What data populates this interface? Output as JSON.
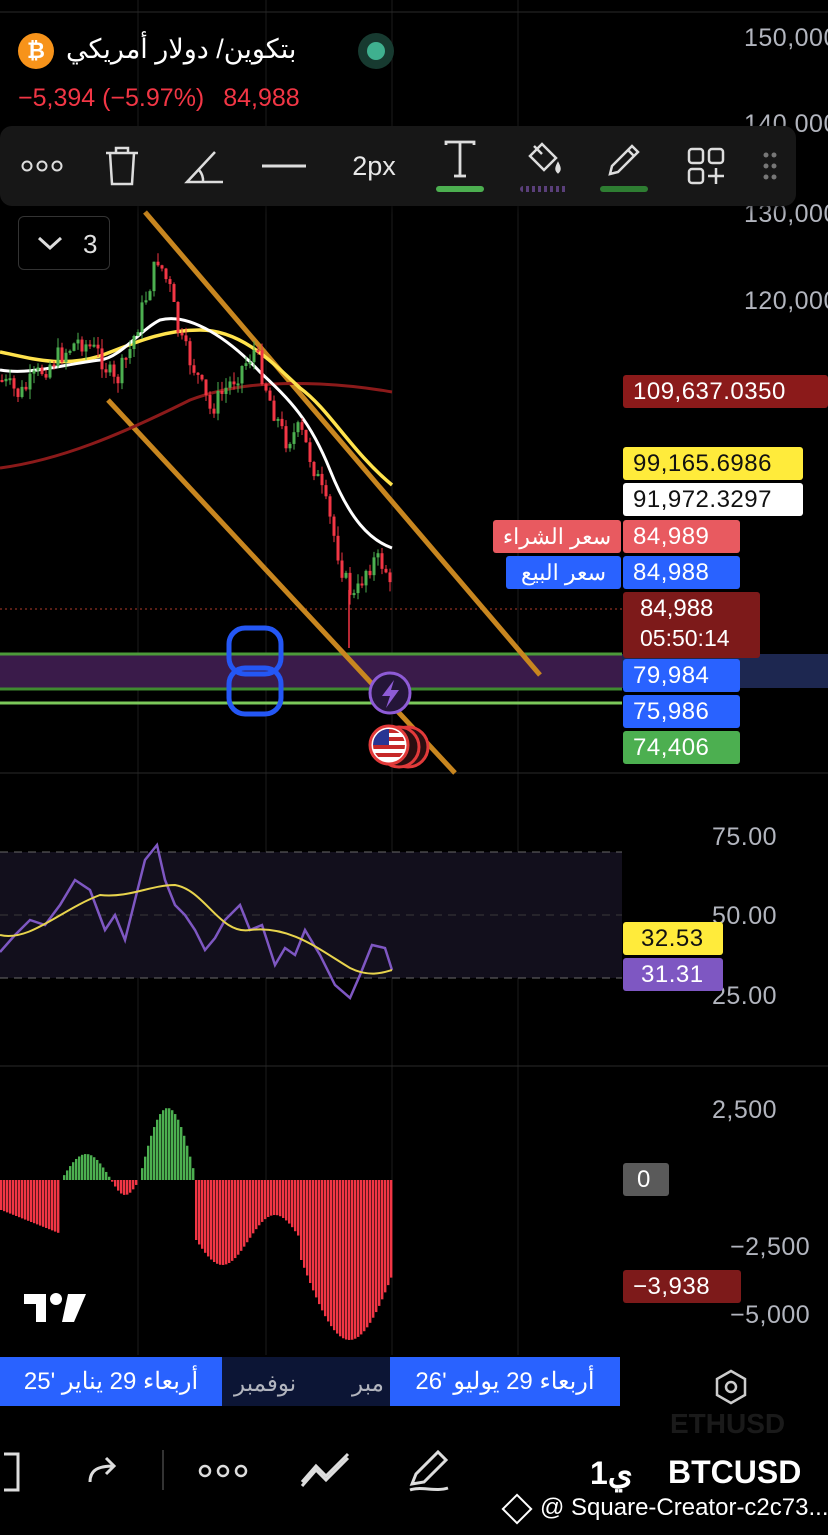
{
  "symbol": {
    "title": "بتكوين/ دولار أمريكي",
    "change": "−5,394 (−5.97%)",
    "price": "84,988",
    "icon": "bitcoin-icon"
  },
  "toolbar": {
    "more_label": "∘∘∘",
    "width_label": "2px"
  },
  "legend": {
    "collapse_count": "3"
  },
  "price_axis": [
    "150,000",
    "140,000",
    "130,000",
    "120,000"
  ],
  "price_badges": {
    "ma200": "109,637.0350",
    "ma_yellow": "99,165.6986",
    "ma_white": "91,972.3297",
    "buy_label": "سعر الشراء",
    "buy_price": "84,989",
    "sell_label": "سعر البيع",
    "sell_price": "84,988",
    "last_price": "84,988",
    "countdown": "05:50:14",
    "line1": "79,984",
    "line2": "75,986",
    "line3": "74,406"
  },
  "rsi": {
    "axis": [
      "75.00",
      "50.00",
      "25.00"
    ],
    "ma_value": "32.53",
    "rsi_value": "31.31"
  },
  "macd": {
    "axis": [
      "2,500",
      "0",
      "−2,500",
      "−5,000"
    ],
    "value": "−3,938"
  },
  "time_axis": {
    "left_badge": "أربعاء 29 يناير '25",
    "mid_label": "نوفمبر",
    "partial_label": "مبر",
    "right_badge": "أربعاء 29 يوليو '26"
  },
  "bottom": {
    "interval": "1ي",
    "ticker": "BTCUSD",
    "ghost_ticker": "ETHUSD",
    "more": "∘∘∘",
    "credit": "@ Square-Creator-c2c73..."
  },
  "colors": {
    "bg": "#000000",
    "up": "#4caf50",
    "down": "#f23645",
    "ma200": "#8b1a1a",
    "ma_yellow": "#ffeb3b",
    "channel": "#c8861f",
    "blue_badge": "#2962ff",
    "rsi_line": "#7e57c2"
  }
}
